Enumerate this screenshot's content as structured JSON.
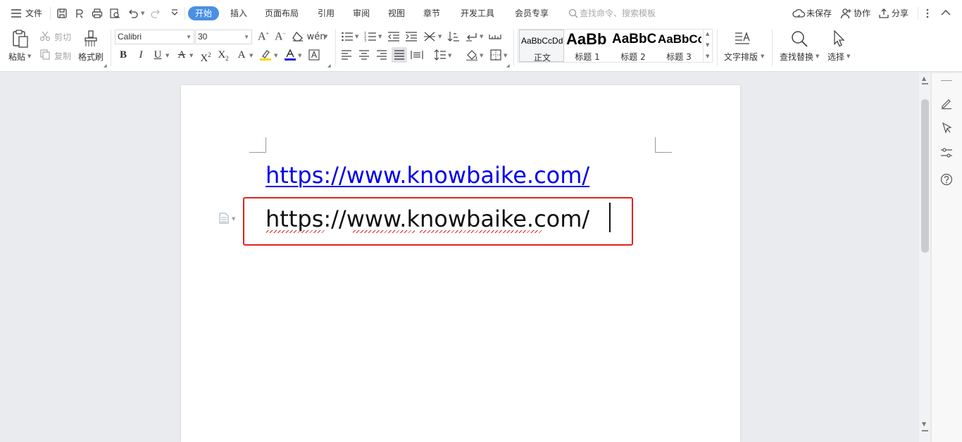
{
  "menubar": {
    "file_label": "文件",
    "tabs": [
      {
        "label": "开始",
        "active": true
      },
      {
        "label": "插入"
      },
      {
        "label": "页面布局"
      },
      {
        "label": "引用"
      },
      {
        "label": "审阅"
      },
      {
        "label": "视图"
      },
      {
        "label": "章节"
      },
      {
        "label": "开发工具"
      },
      {
        "label": "会员专享"
      }
    ],
    "search_placeholder": "查找命令、搜索模板",
    "right": {
      "unsaved_label": "未保存",
      "collab_label": "协作",
      "share_label": "分享"
    }
  },
  "ribbon": {
    "paste_label": "粘贴",
    "cut_label": "剪切",
    "copy_label": "复制",
    "format_painter_label": "格式刷",
    "font_name": "Calibri",
    "font_size": "30",
    "styles": [
      {
        "preview": "AaBbCcDd",
        "name": "正文"
      },
      {
        "preview": "AaBb",
        "name": "标题 1"
      },
      {
        "preview": "AaBbC",
        "name": "标题 2"
      },
      {
        "preview": "AaBbCc",
        "name": "标题 3"
      }
    ],
    "text_layout_label": "文字排版",
    "find_replace_label": "查找替换",
    "select_label": "选择"
  },
  "document": {
    "hyperlink_text": "https://www.knowbaike.com/",
    "plain_text": "https://www.knowbaike.com/"
  },
  "colors": {
    "accent": "#4a90e2",
    "link": "#0000ee",
    "highlight_border": "#e0231b",
    "highlight_yellow": "#f5d800",
    "font_color_red": "#e02020"
  }
}
